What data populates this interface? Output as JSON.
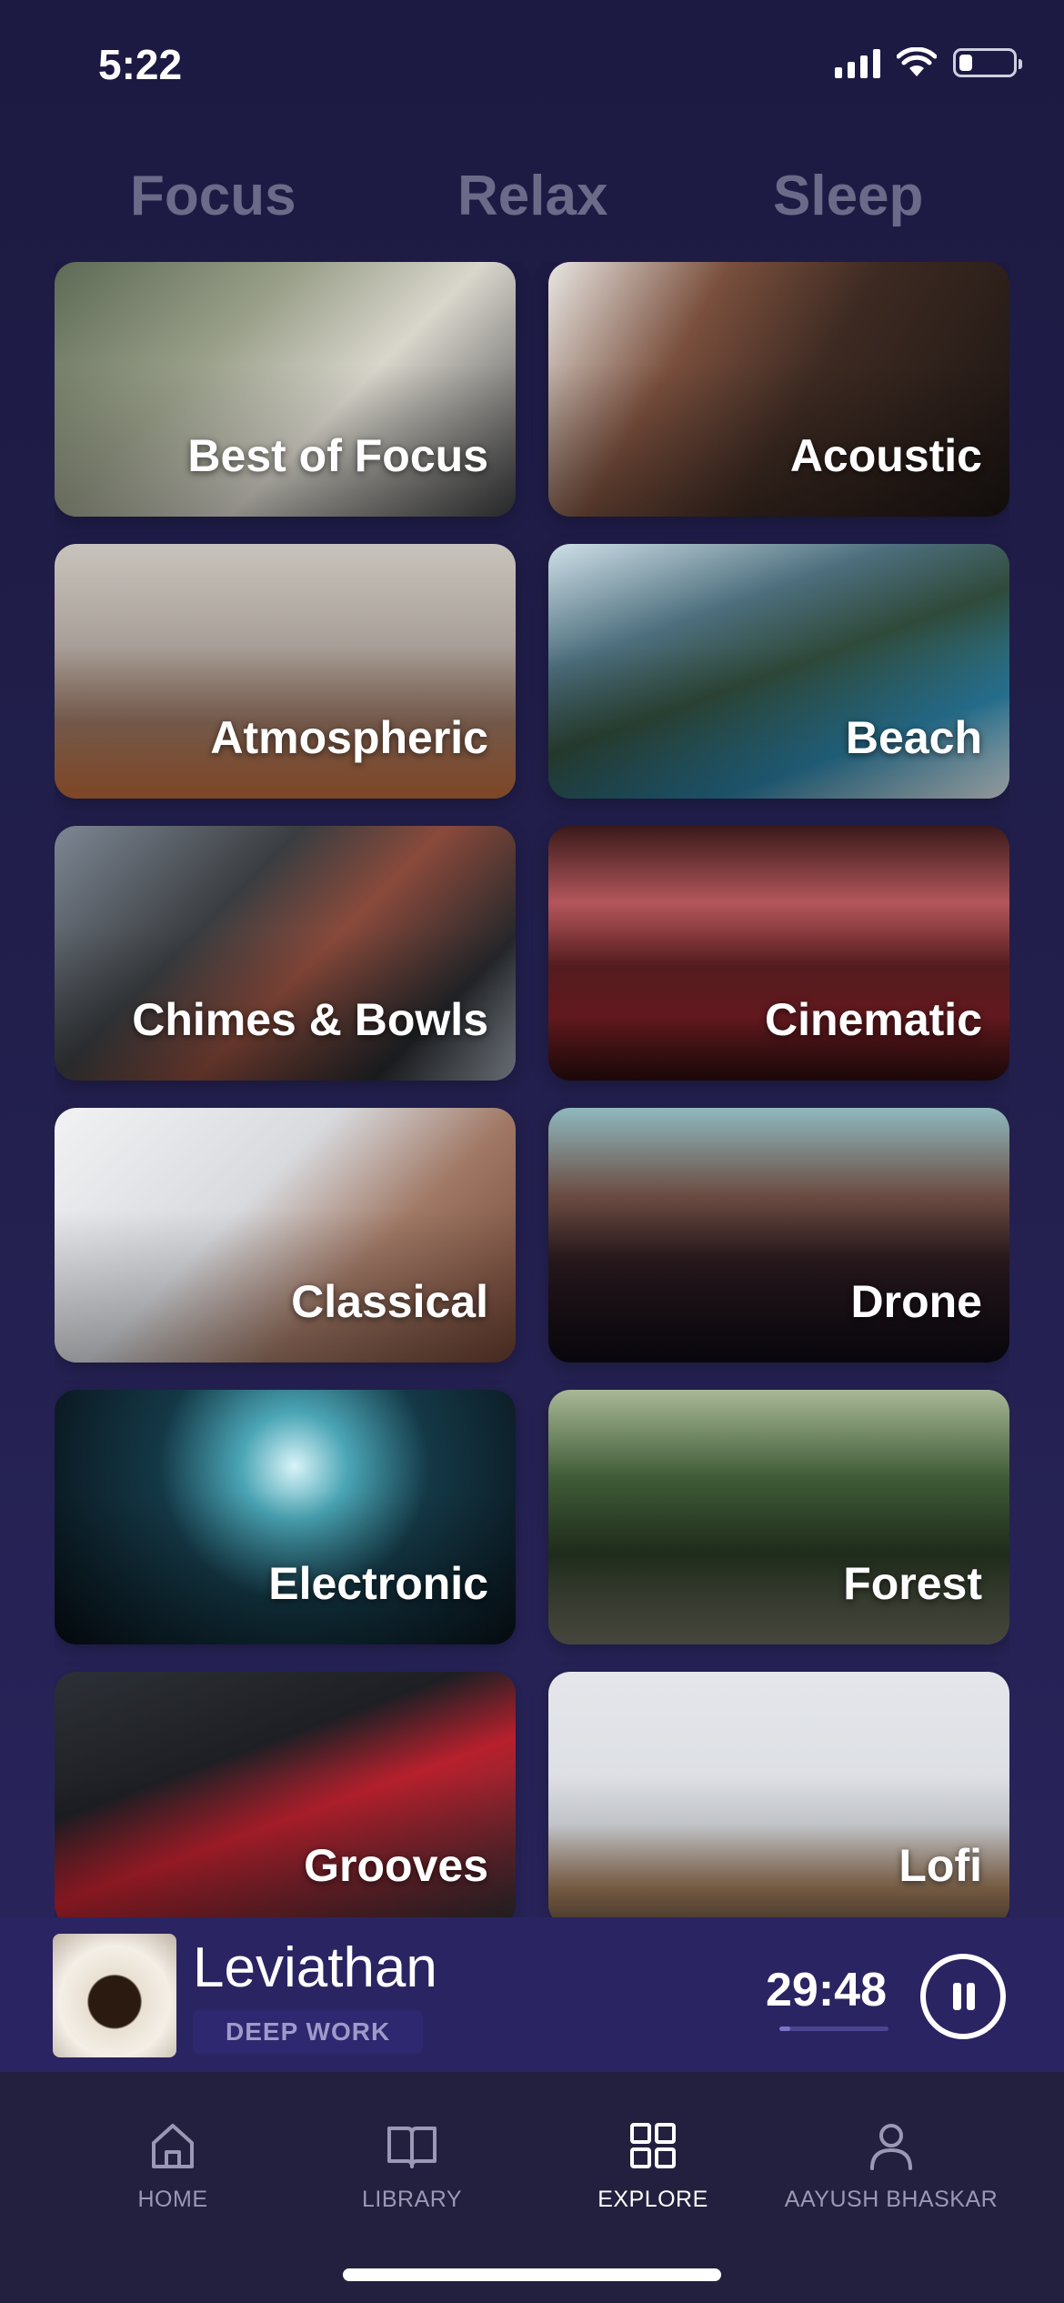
{
  "status_bar": {
    "time": "5:22",
    "battery_level": 0.25
  },
  "tabs": [
    {
      "label": "Focus",
      "active": true
    },
    {
      "label": "Relax",
      "active": false
    },
    {
      "label": "Sleep",
      "active": false
    }
  ],
  "categories": [
    {
      "label": "Best of Focus"
    },
    {
      "label": "Acoustic"
    },
    {
      "label": "Atmospheric"
    },
    {
      "label": "Beach"
    },
    {
      "label": "Chimes & Bowls"
    },
    {
      "label": "Cinematic"
    },
    {
      "label": "Classical"
    },
    {
      "label": "Drone"
    },
    {
      "label": "Electronic"
    },
    {
      "label": "Forest"
    },
    {
      "label": "Grooves"
    },
    {
      "label": "Lofi"
    }
  ],
  "now_playing": {
    "title": "Leviathan",
    "tag": "DEEP WORK",
    "time_remaining": "29:48",
    "progress": 0.1
  },
  "nav": [
    {
      "label": "HOME",
      "icon": "home-icon",
      "active": false
    },
    {
      "label": "LIBRARY",
      "icon": "book-icon",
      "active": false
    },
    {
      "label": "EXPLORE",
      "icon": "grid-icon",
      "active": true
    },
    {
      "label": "AAYUSH BHASKAR",
      "icon": "user-icon",
      "active": false
    }
  ],
  "colors": {
    "background": "#1c1a42",
    "player_bar": "#2a2462",
    "tab_inactive": "#6b6a88",
    "nav_bar": "#221f3f"
  }
}
